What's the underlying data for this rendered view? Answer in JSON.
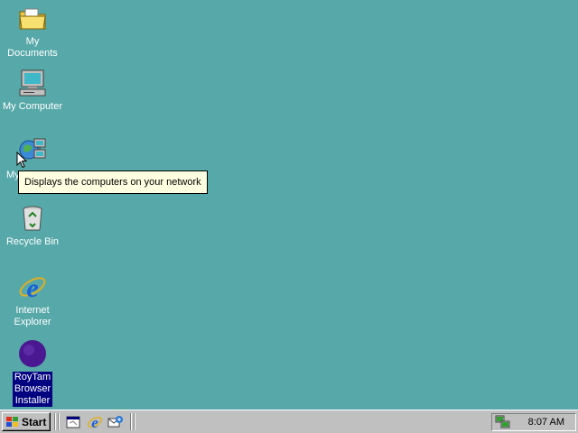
{
  "desktop": {
    "background_color": "#57a8a8",
    "icons": [
      {
        "label": "My Documents",
        "icon": "folder-documents-icon"
      },
      {
        "label": "My Computer",
        "icon": "computer-icon"
      },
      {
        "label": "My Network Places",
        "icon": "network-computers-icon"
      },
      {
        "label": "Recycle Bin",
        "icon": "recycle-bin-icon"
      },
      {
        "label": "Internet Explorer",
        "icon": "internet-explorer-icon"
      },
      {
        "label": "RoyTam Browser Installer",
        "icon": "purple-circle-icon",
        "selected": true
      }
    ],
    "tooltip": "Displays the computers on your network"
  },
  "taskbar": {
    "start_label": "Start",
    "quick_launch": [
      {
        "icon": "show-desktop-icon"
      },
      {
        "icon": "internet-explorer-icon"
      },
      {
        "icon": "outlook-express-icon"
      }
    ],
    "tray_icon": "network-connection-icon",
    "clock": "8:07 AM"
  },
  "colors": {
    "desktop": "#57a8a8",
    "taskbar": "#c0c0c0",
    "selection": "#000080",
    "tooltip_bg": "#ffffe1"
  }
}
